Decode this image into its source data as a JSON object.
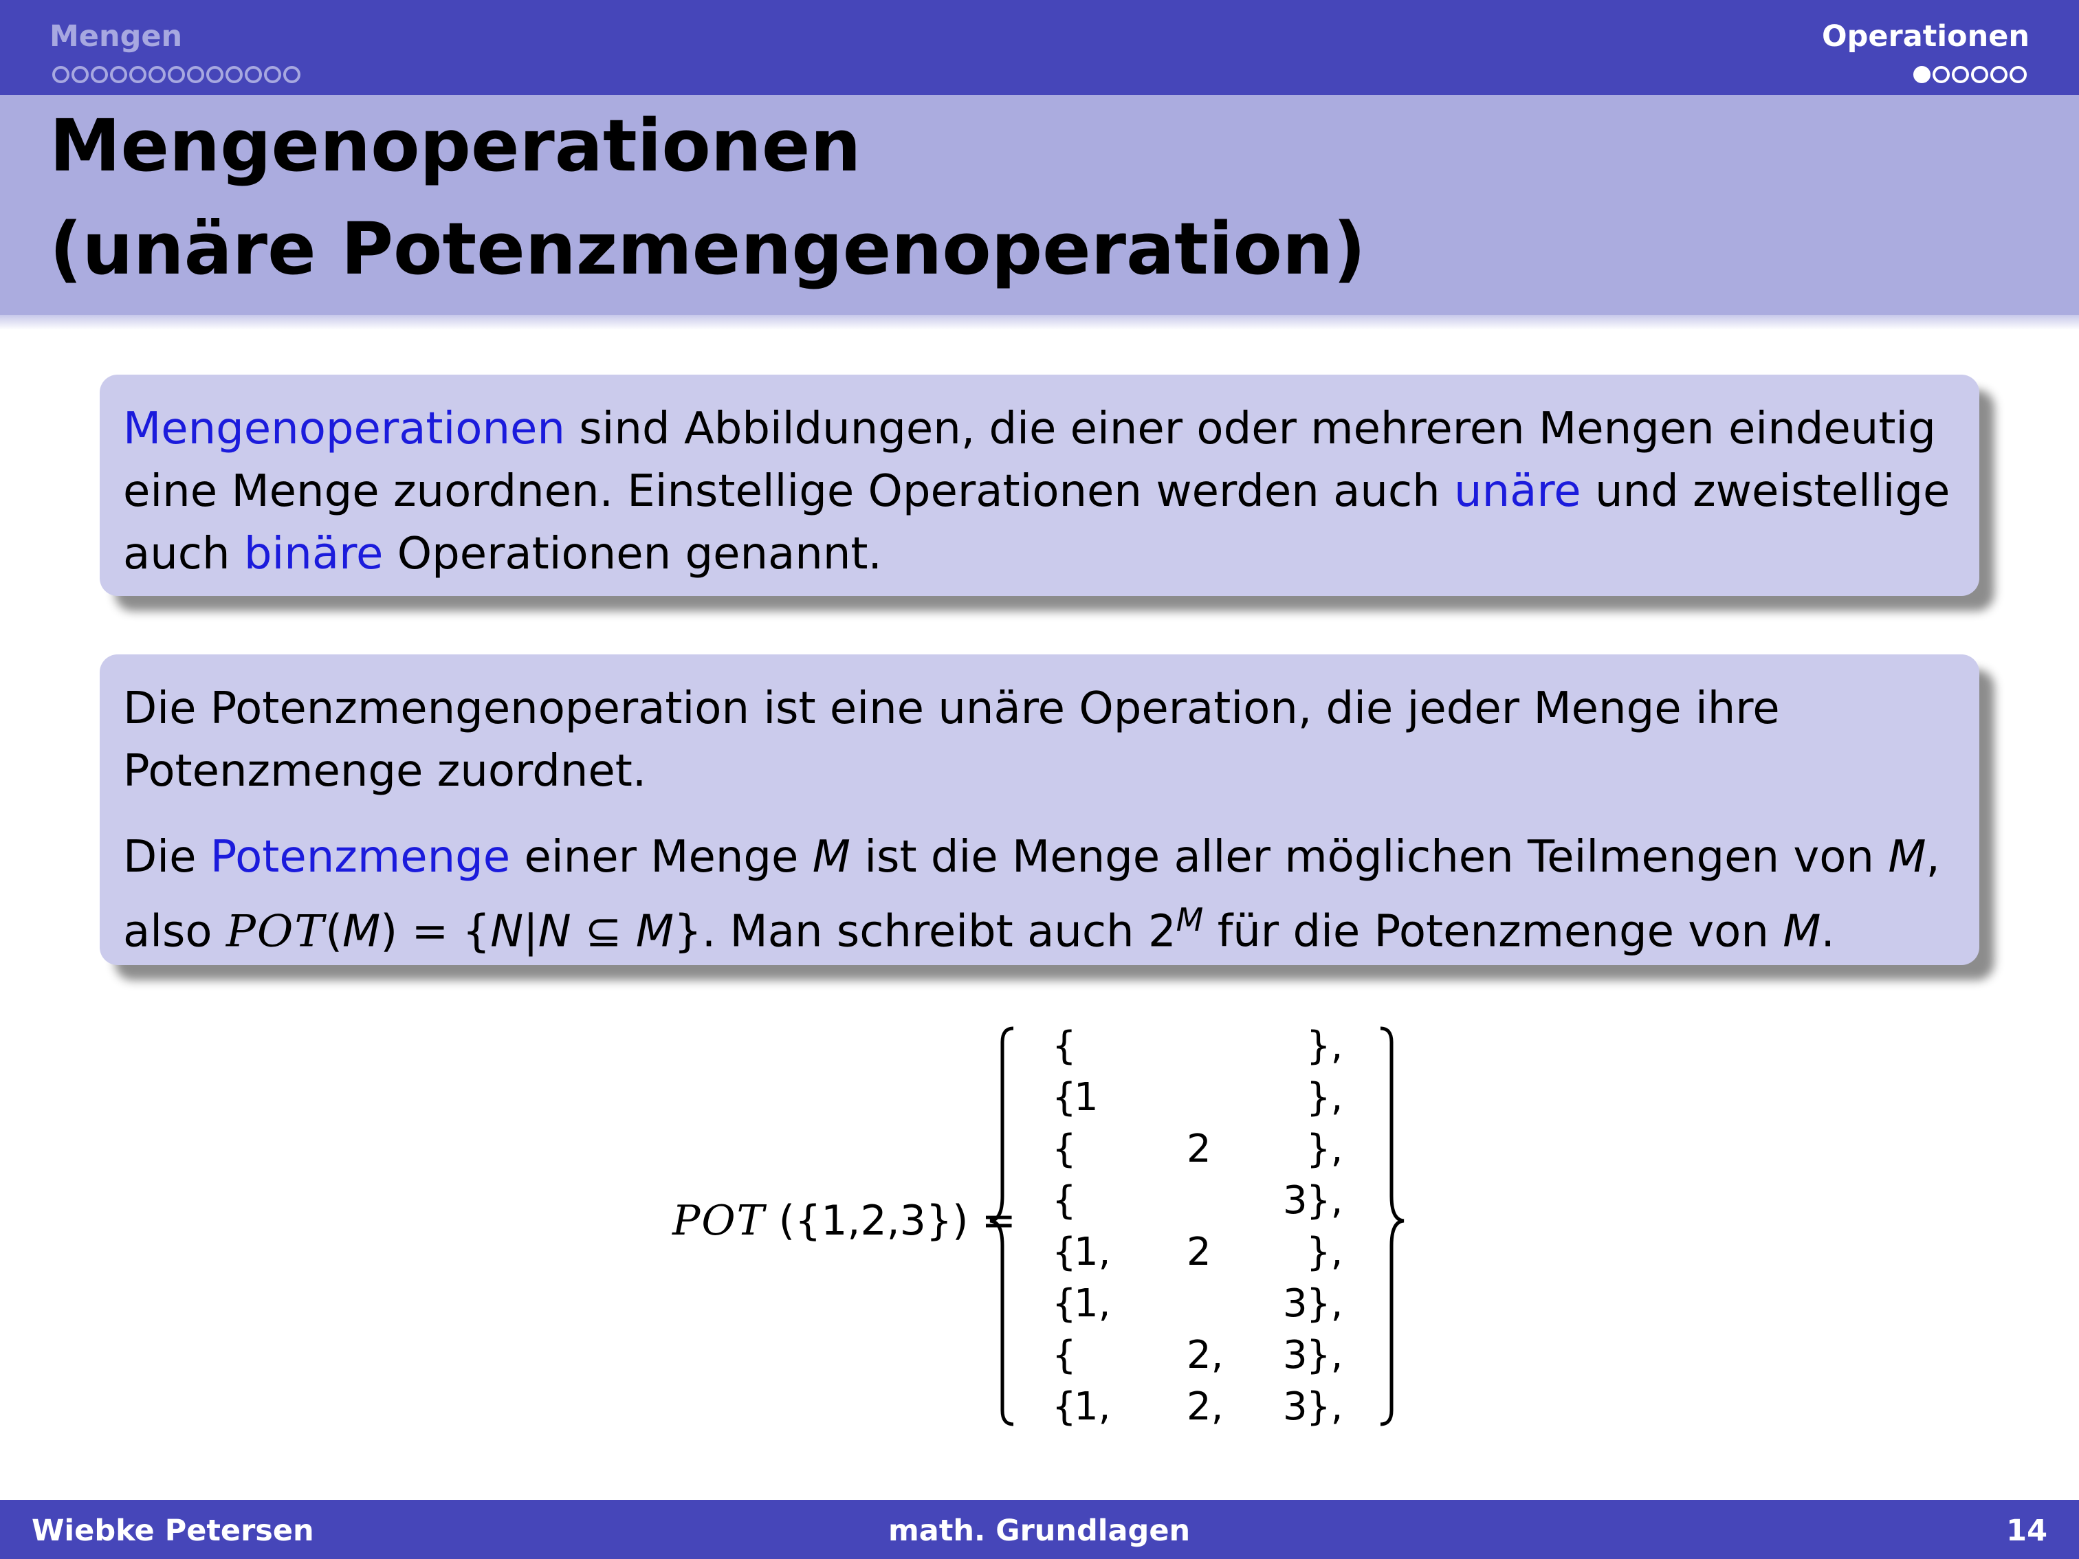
{
  "header": {
    "section_left": "Mengen",
    "section_right": "Operationen",
    "left_dots_total": 13,
    "right_dots_total": 6,
    "right_dots_filled": 1
  },
  "frametitle": {
    "line1": "Mengenoperationen",
    "line2": "(unäre Potenzmengenoperation)"
  },
  "block1": {
    "t1": "Mengenoperationen",
    "t2": " sind Abbildungen, die einer oder mehreren Mengen eindeutig",
    "t3": "eine Menge zuordnen. Einstellige Operationen werden auch ",
    "t4": "unäre",
    "t5": " und zweistellige",
    "t6": "auch ",
    "t7": "binäre",
    "t8": " Operationen genannt."
  },
  "block2": {
    "p1_line1": "Die Potenzmengenoperation ist eine unäre Operation, die jeder Menge ihre",
    "p1_line2": "Potenzmenge zuordnet.",
    "p2_a": "Die ",
    "p2_b": "Potenzmenge",
    "p2_c": " einer Menge ",
    "p2_d": "M",
    "p2_e": " ist die Menge aller möglichen Teilmengen von ",
    "p2_f": "M",
    "p2_g": ",",
    "l2_a": "also ",
    "l2_b": "POT",
    "l2_c": "(",
    "l2_d": "M",
    "l2_e": ") = {",
    "l2_f": "N",
    "l2_g": "|",
    "l2_h": "N",
    "l2_i": " ⊆ ",
    "l2_j": "M",
    "l2_k": "}.  Man schreibt auch 2",
    "l2_l": "M",
    "l2_m": " für die Potenzmenge von ",
    "l2_n": "M",
    "l2_o": "."
  },
  "formula": {
    "lhs_cal": "POT",
    "lhs_rest": "({1,2,3}) =",
    "rows": [
      {
        "open": "{",
        "a": "",
        "b": "",
        "c": "",
        "close": "},"
      },
      {
        "open": "{",
        "a": "1",
        "b": "",
        "c": "",
        "close": "},"
      },
      {
        "open": "{",
        "a": "",
        "b": "2",
        "c": "",
        "close": "},"
      },
      {
        "open": "{",
        "a": "",
        "b": "",
        "c": "3",
        "close": "},"
      },
      {
        "open": "{",
        "a": "1,",
        "b": "2",
        "c": "",
        "close": "},"
      },
      {
        "open": "{",
        "a": "1,",
        "b": "",
        "c": "3",
        "close": "},"
      },
      {
        "open": "{",
        "a": "",
        "b": "2,",
        "c": "3",
        "close": "},"
      },
      {
        "open": "{",
        "a": "1,",
        "b": "2,",
        "c": "3",
        "close": "},"
      }
    ]
  },
  "footer": {
    "author": "Wiebke Petersen",
    "title": "math. Grundlagen",
    "page": "14"
  },
  "colors": {
    "bar": "#4646b9",
    "title_band": "#abacdf",
    "block_bg": "#cbcbec",
    "highlight": "#1b1bdc"
  }
}
